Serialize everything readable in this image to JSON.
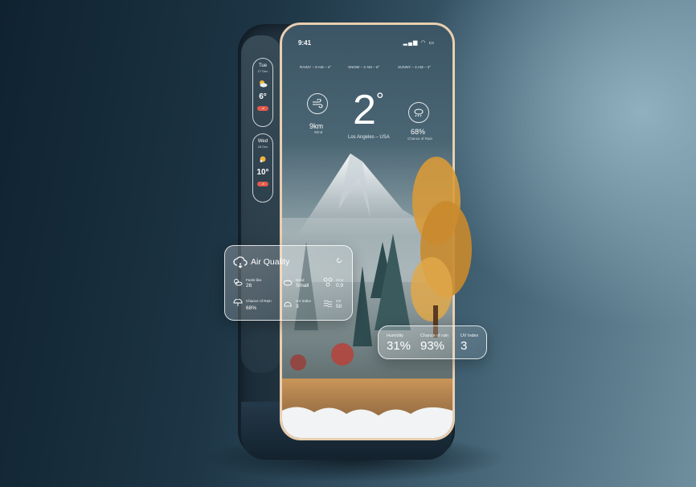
{
  "status": {
    "time": "9:41",
    "icons": "▂▄▆ ◠ ▭"
  },
  "forecast": [
    {
      "label": "RAINY – 9 AM – 4°"
    },
    {
      "label": "SNOW – 2 AM – 6°"
    },
    {
      "label": "SUNNY – 4 AM – 3°"
    }
  ],
  "current": {
    "temperature": "2",
    "degree": "°",
    "location": "Los Angeles – USA",
    "wind_value": "9km",
    "wind_label": "Wind",
    "rain_value": "68%",
    "rain_label": "Chance of Rain"
  },
  "side_days": [
    {
      "name": "Tue",
      "date": "27 Dec",
      "temp": "6°",
      "badge": "-4"
    },
    {
      "name": "Wed",
      "date": "28 Dec",
      "temp": "10°",
      "badge": "-4"
    }
  ],
  "air_quality": {
    "title": "Air Quality",
    "cells": [
      {
        "label": "Feels like",
        "value": "26"
      },
      {
        "label": "Wind",
        "value": "Small"
      },
      {
        "label": "SO2",
        "value": "0.9"
      },
      {
        "label": "Chance of Rain",
        "value": "68%"
      },
      {
        "label": "UV Index",
        "value": "3"
      },
      {
        "label": "O3",
        "value": "50"
      }
    ]
  },
  "summary": [
    {
      "label": "Humidity",
      "value": "31%"
    },
    {
      "label": "Chance of rain",
      "value": "93%"
    },
    {
      "label": "UV Index",
      "value": "3"
    }
  ],
  "colors": {
    "frame": "#e9cfb0",
    "badge": "#e25a4b",
    "tree": "#d89a3a"
  }
}
